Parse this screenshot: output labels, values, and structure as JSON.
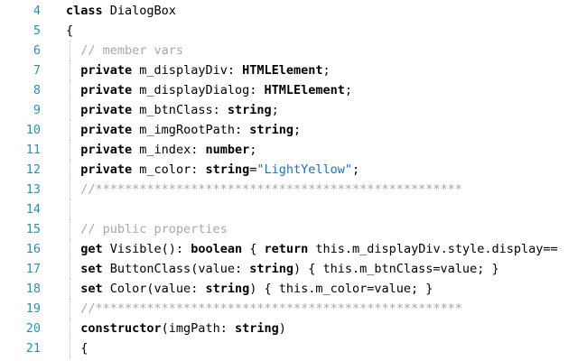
{
  "editor": {
    "colors": {
      "background": "#ffffff",
      "line_number": "#2b91af",
      "comment": "#a8a8a8",
      "string": "#1f6fbf",
      "text": "#000000"
    },
    "lines": [
      {
        "num": "4",
        "tokens": [
          {
            "t": "class",
            "c": "kw"
          },
          {
            "t": " DialogBox"
          }
        ]
      },
      {
        "num": "5",
        "tokens": [
          {
            "t": "{"
          }
        ]
      },
      {
        "num": "6",
        "tokens": [
          {
            "t": "  // member vars",
            "c": "cm"
          }
        ]
      },
      {
        "num": "7",
        "tokens": [
          {
            "t": "  "
          },
          {
            "t": "private",
            "c": "kw"
          },
          {
            "t": " m_displayDiv: "
          },
          {
            "t": "HTMLElement",
            "c": "tp"
          },
          {
            "t": ";"
          }
        ]
      },
      {
        "num": "8",
        "tokens": [
          {
            "t": "  "
          },
          {
            "t": "private",
            "c": "kw"
          },
          {
            "t": " m_displayDialog: "
          },
          {
            "t": "HTMLElement",
            "c": "tp"
          },
          {
            "t": ";"
          }
        ]
      },
      {
        "num": "9",
        "tokens": [
          {
            "t": "  "
          },
          {
            "t": "private",
            "c": "kw"
          },
          {
            "t": " m_btnClass: "
          },
          {
            "t": "string",
            "c": "kw"
          },
          {
            "t": ";"
          }
        ]
      },
      {
        "num": "10",
        "tokens": [
          {
            "t": "  "
          },
          {
            "t": "private",
            "c": "kw"
          },
          {
            "t": " m_imgRootPath: "
          },
          {
            "t": "string",
            "c": "kw"
          },
          {
            "t": ";"
          }
        ]
      },
      {
        "num": "11",
        "tokens": [
          {
            "t": "  "
          },
          {
            "t": "private",
            "c": "kw"
          },
          {
            "t": " m_index: "
          },
          {
            "t": "number",
            "c": "kw"
          },
          {
            "t": ";"
          }
        ]
      },
      {
        "num": "12",
        "tokens": [
          {
            "t": "  "
          },
          {
            "t": "private",
            "c": "kw"
          },
          {
            "t": " m_color: "
          },
          {
            "t": "string",
            "c": "kw"
          },
          {
            "t": "="
          },
          {
            "t": "\"LightYellow\"",
            "c": "str"
          },
          {
            "t": ";"
          }
        ]
      },
      {
        "num": "13",
        "tokens": [
          {
            "t": "  //**************************************************",
            "c": "cm"
          }
        ]
      },
      {
        "num": "14",
        "tokens": []
      },
      {
        "num": "15",
        "tokens": [
          {
            "t": "  // public properties",
            "c": "cm"
          }
        ]
      },
      {
        "num": "16",
        "tokens": [
          {
            "t": "  "
          },
          {
            "t": "get",
            "c": "kw"
          },
          {
            "t": " Visible(): "
          },
          {
            "t": "boolean",
            "c": "kw"
          },
          {
            "t": " { "
          },
          {
            "t": "return",
            "c": "kw"
          },
          {
            "t": " this.m_displayDiv.style.display=="
          }
        ]
      },
      {
        "num": "17",
        "tokens": [
          {
            "t": "  "
          },
          {
            "t": "set",
            "c": "kw"
          },
          {
            "t": " ButtonClass(value: "
          },
          {
            "t": "string",
            "c": "kw"
          },
          {
            "t": ") { this.m_btnClass=value; }"
          }
        ]
      },
      {
        "num": "18",
        "tokens": [
          {
            "t": "  "
          },
          {
            "t": "set",
            "c": "kw"
          },
          {
            "t": " Color(value: "
          },
          {
            "t": "string",
            "c": "kw"
          },
          {
            "t": ") { this.m_color=value; }"
          }
        ]
      },
      {
        "num": "19",
        "tokens": [
          {
            "t": "  //**************************************************",
            "c": "cm"
          }
        ]
      },
      {
        "num": "20",
        "tokens": [
          {
            "t": "  "
          },
          {
            "t": "constructor",
            "c": "kw"
          },
          {
            "t": "(imgPath: "
          },
          {
            "t": "string",
            "c": "kw"
          },
          {
            "t": ")"
          }
        ]
      },
      {
        "num": "21",
        "tokens": [
          {
            "t": "  {"
          }
        ]
      }
    ]
  }
}
